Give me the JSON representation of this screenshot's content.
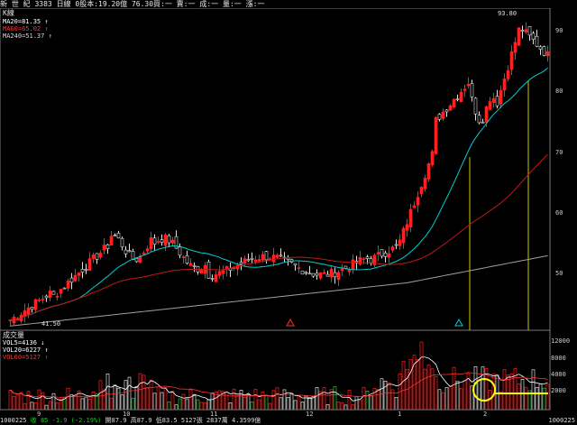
{
  "header": {
    "stock_name": "新 世 紀",
    "code": "3383",
    "period": "日線",
    "share_capital": "0股本:19.20億",
    "bid": "76.30買:一",
    "ask": "賣:一",
    "deal": "成:一",
    "change": "量:一",
    "lift": "漲:一"
  },
  "price_pane": {
    "title": "K線",
    "ma_labels": [
      {
        "text": "MA20=81.35 ↑",
        "color": "#ffffff"
      },
      {
        "text": "MA60=65.02 ↑",
        "color": "#ff3030"
      },
      {
        "text": "MA240=51.37 ↑",
        "color": "#d8d8d8"
      }
    ],
    "high_label": "93.80",
    "low_label": "41.50",
    "y_ticks": [
      "90",
      "80",
      "70",
      "60",
      "50"
    ]
  },
  "volume_pane": {
    "title": "成交量",
    "labels": [
      {
        "text": "VOL5=4136 ↓",
        "color": "#ffffff"
      },
      {
        "text": "VOL20=6227 ↑",
        "color": "#ffffff"
      },
      {
        "text": "VOL60=5127 ↑",
        "color": "#ff3030"
      }
    ],
    "y_ticks": [
      "12000",
      "8000",
      "4000",
      "2000"
    ]
  },
  "x_axis": {
    "labels": [
      "9",
      "10",
      "11",
      "12",
      "1",
      "2"
    ]
  },
  "footer": {
    "date": "1000225",
    "close": "收 85",
    "change": "-1.9 (-2.19%)",
    "open": "開87.9",
    "high": "高87.9",
    "low": "低83.5",
    "volume": "5127張",
    "amount": "2837萬",
    "turnover": "4.3599億",
    "right_date": "1000225"
  },
  "colors": {
    "up": "#ff2020",
    "down": "#e0e0e0",
    "ma20": "#00d0d0",
    "ma60": "#c01818",
    "ma240": "#a0a0a0",
    "marker": "#c8c800",
    "circle": "#ffff00"
  }
}
